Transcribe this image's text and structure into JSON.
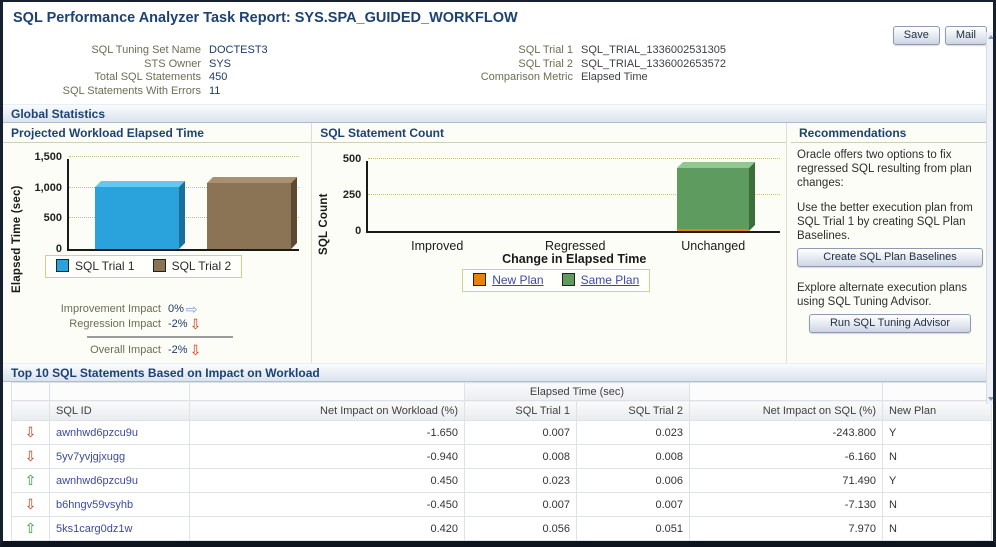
{
  "page": {
    "title": "SQL Performance Analyzer Task Report: SYS.SPA_GUIDED_WORKFLOW"
  },
  "toolbar": {
    "save": "Save",
    "mail": "Mail"
  },
  "summary": {
    "left": [
      {
        "label": "SQL Tuning Set Name",
        "value": "DOCTEST3"
      },
      {
        "label": "STS Owner",
        "value": "SYS"
      },
      {
        "label": "Total SQL Statements",
        "value": "450"
      },
      {
        "label": "SQL Statements With Errors",
        "value": "11"
      }
    ],
    "right": [
      {
        "label": "SQL Trial 1",
        "value": "SQL_TRIAL_1336002531305"
      },
      {
        "label": "SQL Trial 2",
        "value": "SQL_TRIAL_1336002653572"
      },
      {
        "label": "Comparison Metric",
        "value": "Elapsed Time"
      }
    ]
  },
  "sections": {
    "global_statistics": "Global Statistics",
    "top_sql": "Top 10 SQL Statements Based on Impact on Workload"
  },
  "chart_data": [
    {
      "type": "bar",
      "title": "Projected Workload Elapsed Time",
      "ylabel": "Elapsed Time (sec)",
      "categories": [
        "SQL Trial 1",
        "SQL Trial 2"
      ],
      "values": [
        1010,
        1070
      ],
      "colors": [
        "#2aa3dc",
        "#8b7355"
      ],
      "top_colors": [
        "#63c8f0",
        "#a9916f"
      ],
      "side_colors": [
        "#1a6f9c",
        "#5d4a32"
      ],
      "ylim": [
        0,
        1500
      ],
      "yticks": [
        0,
        500,
        1000,
        1500
      ],
      "ytick_labels": [
        "0",
        "500",
        "1,000",
        "1,500"
      ],
      "legend": [
        "SQL Trial 1",
        "SQL Trial 2"
      ],
      "legend_position": "bottom",
      "grid": "horizontal-dotted"
    },
    {
      "type": "bar",
      "stacked": true,
      "title": "SQL Statement Count",
      "ylabel": "SQL Count",
      "xlabel": "Change in Elapsed Time",
      "categories": [
        "Improved",
        "Regressed",
        "Unchanged"
      ],
      "series": [
        {
          "name": "New Plan",
          "color": "#e8820c",
          "top_color": "#f2a84a",
          "side_color": "#a85c06",
          "values": [
            0,
            0,
            6
          ]
        },
        {
          "name": "Same Plan",
          "color": "#5e9b5e",
          "top_color": "#90c890",
          "side_color": "#3c6e3c",
          "values": [
            0,
            0,
            424
          ]
        }
      ],
      "ylim": [
        0,
        500
      ],
      "yticks": [
        0,
        250,
        500
      ],
      "ytick_labels": [
        "0",
        "250",
        "500"
      ],
      "legend_position": "bottom",
      "grid": "horizontal-dotted"
    }
  ],
  "impacts": {
    "rows": [
      {
        "label": "Improvement Impact",
        "value": "0%",
        "arrow": "right"
      },
      {
        "label": "Regression Impact",
        "value": "-2%",
        "arrow": "down"
      }
    ],
    "overall": {
      "label": "Overall Impact",
      "value": "-2%",
      "arrow": "down"
    }
  },
  "recommendations": {
    "title": "Recommendations",
    "paragraphs": [
      "Oracle offers two options to fix regressed SQL resulting from plan changes:",
      "Use the better execution plan from SQL Trial 1 by creating SQL Plan Baselines.",
      "Explore alternate execution plans using SQL Tuning Advisor."
    ],
    "buttons": [
      "Create SQL Plan Baselines",
      "Run SQL Tuning Advisor"
    ]
  },
  "table": {
    "group_header": "Elapsed Time (sec)",
    "columns": [
      "SQL ID",
      "Net Impact on Workload (%)",
      "SQL Trial 1",
      "SQL Trial 2",
      "Net Impact on SQL (%)",
      "New Plan"
    ],
    "rows": [
      {
        "trend": "down",
        "sql_id": "awnhwd6pzcu9u",
        "net_impact_workload": "-1.650",
        "trial1": "0.007",
        "trial2": "0.023",
        "net_impact_sql": "-243.800",
        "new_plan": "Y"
      },
      {
        "trend": "down",
        "sql_id": "5yv7yvjgjxugg",
        "net_impact_workload": "-0.940",
        "trial1": "0.008",
        "trial2": "0.008",
        "net_impact_sql": "-6.160",
        "new_plan": "N"
      },
      {
        "trend": "up",
        "sql_id": "awnhwd6pzcu9u",
        "net_impact_workload": "0.450",
        "trial1": "0.023",
        "trial2": "0.006",
        "net_impact_sql": "71.490",
        "new_plan": "Y"
      },
      {
        "trend": "down",
        "sql_id": "b6hngv59vsyhb",
        "net_impact_workload": "-0.450",
        "trial1": "0.007",
        "trial2": "0.007",
        "net_impact_sql": "-7.130",
        "new_plan": "N"
      },
      {
        "trend": "up",
        "sql_id": "5ks1carg0dz1w",
        "net_impact_workload": "0.420",
        "trial1": "0.056",
        "trial2": "0.051",
        "net_impact_sql": "7.970",
        "new_plan": "N"
      }
    ]
  },
  "colors": {
    "heading_navy": "#1c4273",
    "trial1_blue": "#2aa3dc",
    "trial2_brown": "#8b7355",
    "new_plan_orange": "#e8820c",
    "same_plan_green": "#5e9b5e",
    "regression_red": "#d23715",
    "improvement_green": "#2e9b2e",
    "link_blue": "#3b49a6"
  }
}
